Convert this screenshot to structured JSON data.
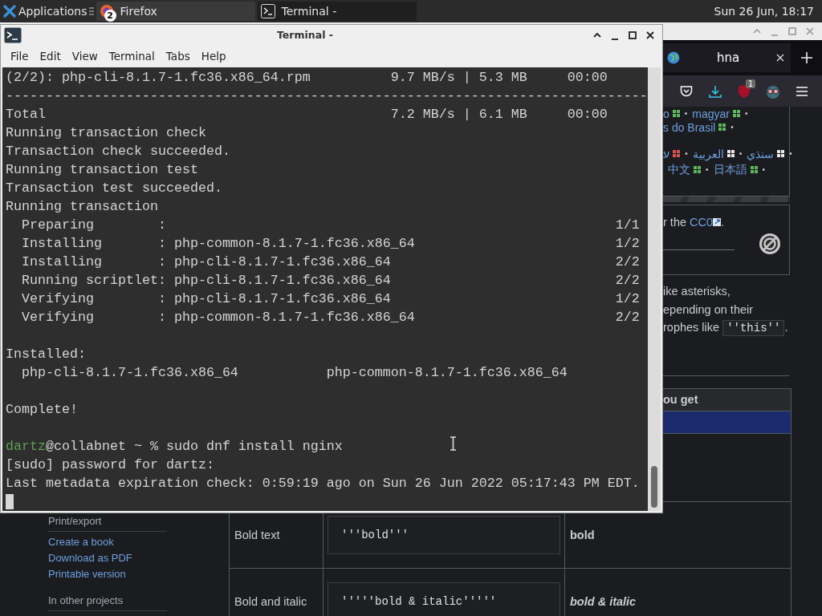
{
  "top_panel": {
    "applications": "Applications",
    "tasks": [
      {
        "kind": "firefox",
        "label": "Firefox",
        "badge": "2",
        "selected": false
      },
      {
        "kind": "terminal",
        "label": "Terminal -",
        "selected": true
      }
    ],
    "clock": "Sun 26 Jun, 18:17"
  },
  "browser": {
    "tab": {
      "title": "hna"
    },
    "toolbar": {
      "extension_badge": "1"
    },
    "languages": {
      "separator": "•",
      "lines": [
        {
          "kind": "ltr",
          "items": [
            {
              "name": "o",
              "color": "#5cb85c"
            },
            {
              "name": "magyar",
              "color": "#5cb85c"
            }
          ]
        },
        {
          "kind": "ltr",
          "items": [
            {
              "name": "s do Brasil",
              "color": "#5cb85c"
            }
          ]
        },
        {
          "kind": "rtl",
          "items": [
            {
              "name": "سنڌي",
              "color": "#e8e8e8"
            },
            {
              "name": "العربية",
              "color": "#e8e8e8"
            },
            {
              "name": "ע",
              "color": "#d9534f"
            }
          ]
        },
        {
          "kind": "ltr",
          "items": [
            {
              "name": "中文",
              "color": "#5cb85c"
            },
            {
              "name": "日本語",
              "color": "#5cb85c"
            }
          ]
        }
      ]
    },
    "license": {
      "text": "r the ",
      "link": "CC0",
      "after": "."
    },
    "paragraph": [
      {
        "text": "ike asterisks,"
      },
      {
        "text": "epending on their"
      },
      {
        "text": "rophes like ",
        "code": "''this''",
        "after": "."
      }
    ],
    "table": {
      "header": "ou get",
      "rows": [
        {
          "label": "Bold text",
          "markup": "'''bold'''",
          "result": "bold",
          "kind": "bold"
        },
        {
          "label": "Bold and italic",
          "markup": "'''''bold & italic'''''",
          "result": "bold & italic",
          "kind": "bold_italic"
        }
      ]
    },
    "sidebar": [
      {
        "heading": "Print/export",
        "links": [
          "Create a book",
          "Download as PDF",
          "Printable version"
        ]
      },
      {
        "heading": "In other projects"
      }
    ]
  },
  "terminal": {
    "title": "Terminal -",
    "menu": [
      "File",
      "Edit",
      "View",
      "Terminal",
      "Tabs",
      "Help"
    ],
    "lines": [
      {
        "kind": "text",
        "text": "(2/2): php-cli-8.1.7-1.fc36.x86_64.rpm          9.7 MB/s | 5.3 MB     00:00"
      },
      {
        "kind": "text",
        "text": "--------------------------------------------------------------------------------"
      },
      {
        "kind": "text",
        "text": "Total                                           7.2 MB/s | 6.1 MB     00:00"
      },
      {
        "kind": "text",
        "text": "Running transaction check"
      },
      {
        "kind": "text",
        "text": "Transaction check succeeded."
      },
      {
        "kind": "text",
        "text": "Running transaction test"
      },
      {
        "kind": "text",
        "text": "Transaction test succeeded."
      },
      {
        "kind": "text",
        "text": "Running transaction"
      },
      {
        "kind": "text",
        "text": "  Preparing        :                                                        1/1"
      },
      {
        "kind": "text",
        "text": "  Installing       : php-common-8.1.7-1.fc36.x86_64                         1/2"
      },
      {
        "kind": "text",
        "text": "  Installing       : php-cli-8.1.7-1.fc36.x86_64                            2/2"
      },
      {
        "kind": "text",
        "text": "  Running scriptlet: php-cli-8.1.7-1.fc36.x86_64                            2/2"
      },
      {
        "kind": "text",
        "text": "  Verifying        : php-cli-8.1.7-1.fc36.x86_64                            1/2"
      },
      {
        "kind": "text",
        "text": "  Verifying        : php-common-8.1.7-1.fc36.x86_64                         2/2"
      },
      {
        "kind": "blank"
      },
      {
        "kind": "text",
        "text": "Installed:"
      },
      {
        "kind": "text",
        "text": "  php-cli-8.1.7-1.fc36.x86_64           php-common-8.1.7-1.fc36.x86_64"
      },
      {
        "kind": "blank"
      },
      {
        "kind": "text",
        "text": "Complete!"
      },
      {
        "kind": "blank"
      },
      {
        "kind": "prompt",
        "user": "dartz",
        "text": "@collabnet ~ % sudo dnf install nginx"
      },
      {
        "kind": "text",
        "text": "[sudo] password for dartz:"
      },
      {
        "kind": "text",
        "text": "Last metadata expiration check: 0:59:19 ago on Sun 26 Jun 2022 05:17:43 PM EDT."
      },
      {
        "kind": "cursor"
      }
    ]
  }
}
